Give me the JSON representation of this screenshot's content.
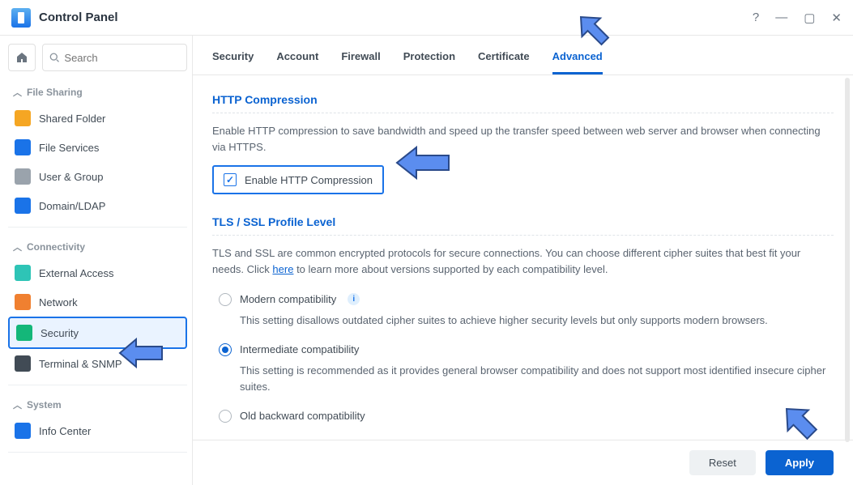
{
  "titlebar": {
    "title": "Control Panel"
  },
  "search": {
    "placeholder": "Search"
  },
  "sidebar": {
    "sections": [
      {
        "title": "File Sharing",
        "items": [
          {
            "label": "Shared Folder",
            "icon": "folder-icon",
            "color": "#f5a623"
          },
          {
            "label": "File Services",
            "icon": "file-services-icon",
            "color": "#1a73e8"
          },
          {
            "label": "User & Group",
            "icon": "users-icon",
            "color": "#9aa3ac"
          },
          {
            "label": "Domain/LDAP",
            "icon": "domain-icon",
            "color": "#1a73e8"
          }
        ]
      },
      {
        "title": "Connectivity",
        "items": [
          {
            "label": "External Access",
            "icon": "globe-icon",
            "color": "#2ec4b6"
          },
          {
            "label": "Network",
            "icon": "network-icon",
            "color": "#f08030"
          },
          {
            "label": "Security",
            "icon": "shield-icon",
            "color": "#14b779",
            "selected": true
          },
          {
            "label": "Terminal & SNMP",
            "icon": "terminal-icon",
            "color": "#414b55"
          }
        ]
      },
      {
        "title": "System",
        "items": [
          {
            "label": "Info Center",
            "icon": "info-icon",
            "color": "#1a73e8"
          }
        ]
      }
    ]
  },
  "tabs": [
    "Security",
    "Account",
    "Firewall",
    "Protection",
    "Certificate",
    "Advanced"
  ],
  "active_tab": "Advanced",
  "sections": {
    "http": {
      "title": "HTTP Compression",
      "desc": "Enable HTTP compression to save bandwidth and speed up the transfer speed between web server and browser when connecting via HTTPS.",
      "checkbox_label": "Enable HTTP Compression",
      "checked": true
    },
    "tls": {
      "title": "TLS / SSL Profile Level",
      "desc_pre": "TLS and SSL are common encrypted protocols for secure connections. You can choose different cipher suites that best fit your needs. Click ",
      "link": "here",
      "desc_post": " to learn more about versions supported by each compatibility level.",
      "options": [
        {
          "label": "Modern compatibility",
          "info": true,
          "selected": false,
          "desc": "This setting disallows outdated cipher suites to achieve higher security levels but only supports modern browsers."
        },
        {
          "label": "Intermediate compatibility",
          "info": false,
          "selected": true,
          "desc": "This setting is recommended as it provides general browser compatibility and does not support most identified insecure cipher suites."
        },
        {
          "label": "Old backward compatibility",
          "info": false,
          "selected": false,
          "desc": ""
        }
      ]
    }
  },
  "footer": {
    "reset": "Reset",
    "apply": "Apply"
  }
}
